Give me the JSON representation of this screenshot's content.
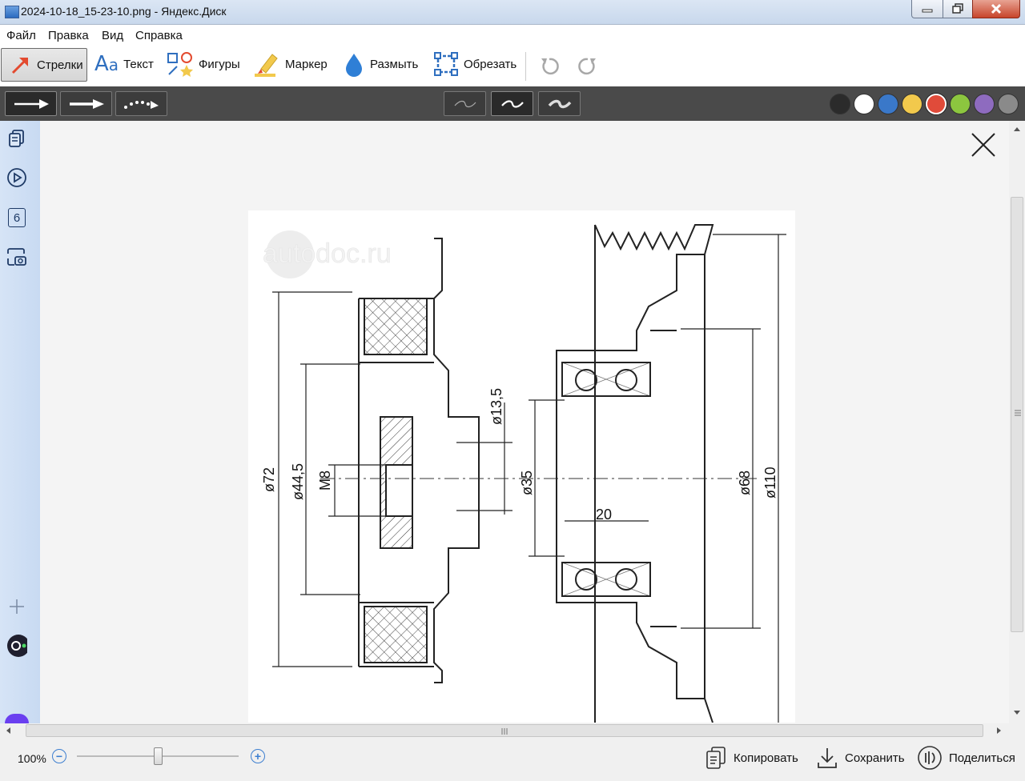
{
  "window": {
    "title": "2024-10-18_15-23-10.png - Яндекс.Диск"
  },
  "menu": {
    "items": [
      "Файл",
      "Правка",
      "Вид",
      "Справка"
    ]
  },
  "toolbar": {
    "tools": [
      {
        "label": "Стрелки",
        "icon": "arrow-tool-icon",
        "selected": true
      },
      {
        "label": "Текст",
        "icon": "text-tool-icon"
      },
      {
        "label": "Фигуры",
        "icon": "shapes-tool-icon"
      },
      {
        "label": "Маркер",
        "icon": "marker-tool-icon"
      },
      {
        "label": "Размыть",
        "icon": "blur-tool-icon"
      },
      {
        "label": "Обрезать",
        "icon": "crop-tool-icon"
      }
    ],
    "undo_icon": "undo-icon",
    "redo_icon": "redo-icon"
  },
  "options": {
    "arrow_styles": [
      "solid-arrow",
      "thick-arrow",
      "dotted-arrow"
    ],
    "stroke_widths": [
      "thin",
      "medium",
      "thick"
    ],
    "selected_stroke": "medium",
    "colors": [
      "#2b2b2b",
      "#ffffff",
      "#3a78c9",
      "#f2c94c",
      "#e04b3a",
      "#8cc63f",
      "#8e6bbf",
      "#8a8a8a"
    ],
    "selected_color": "#e04b3a"
  },
  "sidebar": {
    "items": [
      {
        "icon": "copy-pages-icon"
      },
      {
        "icon": "play-icon"
      },
      {
        "icon": "counter-icon",
        "label": "6"
      },
      {
        "icon": "screenshot-icon"
      },
      {
        "icon": "add-icon"
      },
      {
        "icon": "alice-assistant-icon"
      }
    ]
  },
  "drawing": {
    "watermark": "autodoc.ru",
    "dimensions": [
      "ø72",
      "ø44,5",
      "M8",
      "ø13,5",
      "ø35",
      "20",
      "ø68",
      "ø110"
    ]
  },
  "zoom": {
    "label": "100%",
    "level_percent": 100
  },
  "actions": [
    {
      "label": "Копировать",
      "icon": "copy-icon"
    },
    {
      "label": "Сохранить",
      "icon": "download-icon"
    },
    {
      "label": "Поделиться",
      "icon": "share-icon"
    }
  ]
}
